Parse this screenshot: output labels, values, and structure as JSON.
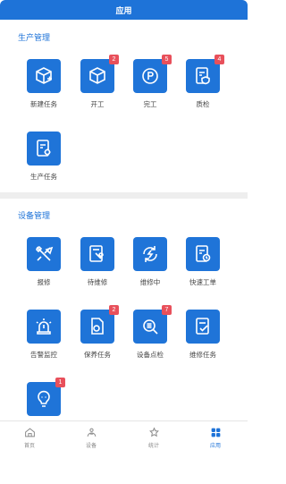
{
  "header": {
    "title": "应用"
  },
  "sections": [
    {
      "title": "生产管理",
      "items": [
        {
          "label": "新建任务",
          "badge": null
        },
        {
          "label": "开工",
          "badge": "2"
        },
        {
          "label": "完工",
          "badge": "5"
        },
        {
          "label": "质检",
          "badge": "4"
        },
        {
          "label": "生产任务",
          "badge": null
        }
      ]
    },
    {
      "title": "设备管理",
      "items": [
        {
          "label": "报修",
          "badge": null
        },
        {
          "label": "待维修",
          "badge": null
        },
        {
          "label": "维修中",
          "badge": null
        },
        {
          "label": "快速工单",
          "badge": null
        },
        {
          "label": "告警监控",
          "badge": null
        },
        {
          "label": "保养任务",
          "badge": "2"
        },
        {
          "label": "设备点检",
          "badge": "7"
        },
        {
          "label": "维修任务",
          "badge": null
        },
        {
          "label": "",
          "badge": "1"
        }
      ]
    }
  ],
  "tabbar": {
    "items": [
      {
        "label": "首页",
        "icon": "home-icon"
      },
      {
        "label": "设备",
        "icon": "equipment-icon"
      },
      {
        "label": "统计",
        "icon": "stats-icon"
      },
      {
        "label": "应用",
        "icon": "apps-icon"
      }
    ]
  },
  "colors": {
    "primary": "#1e73d8",
    "badge": "#e8505b"
  }
}
